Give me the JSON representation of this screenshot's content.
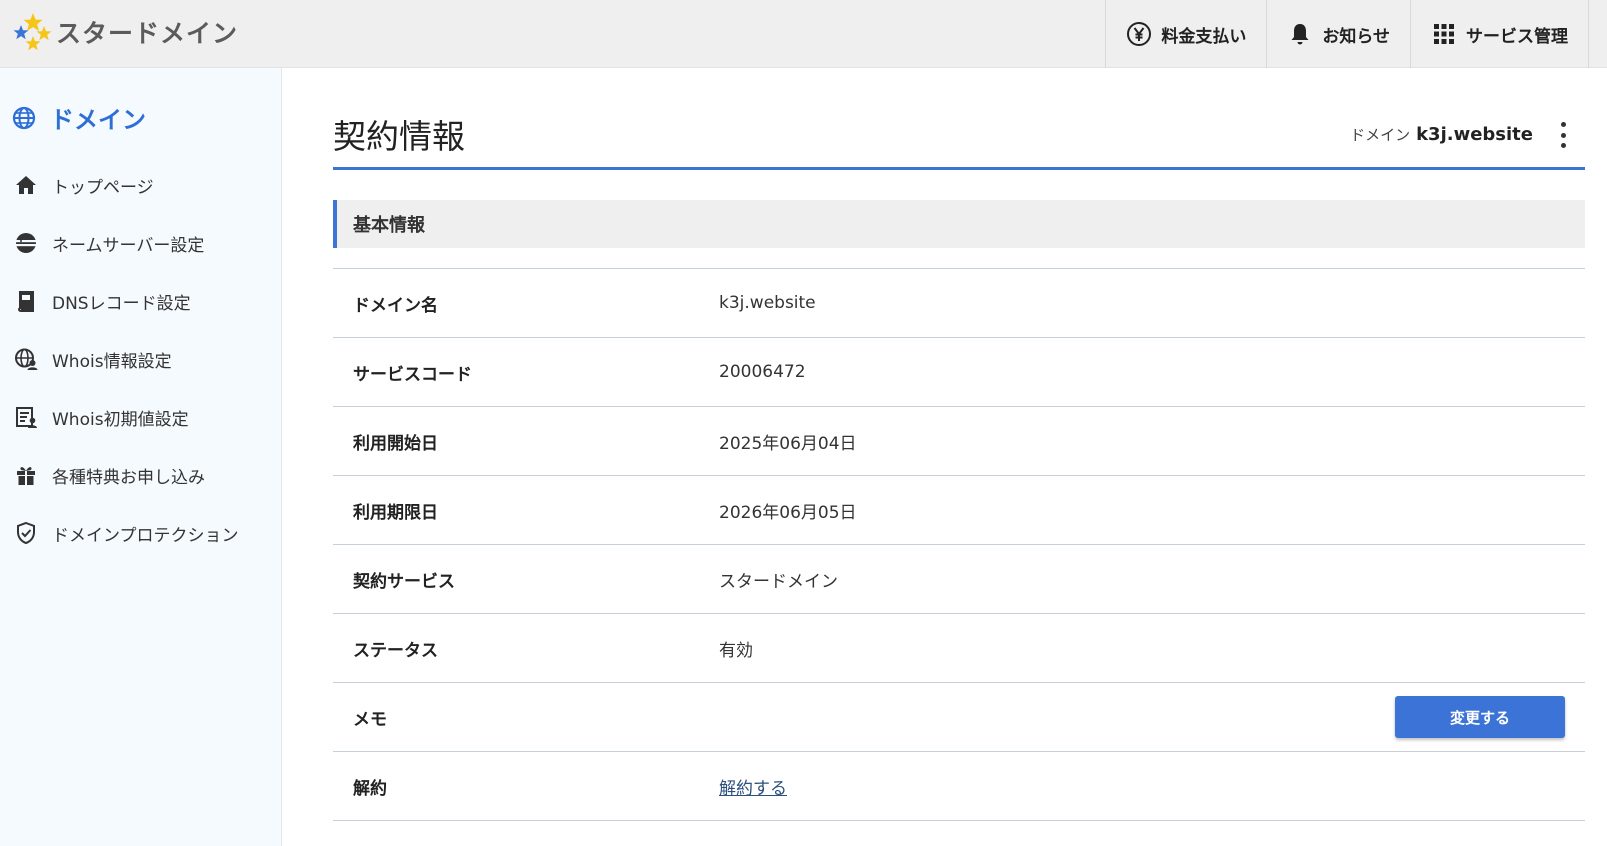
{
  "header": {
    "logo_text": "スタードメイン",
    "nav": [
      {
        "label": "料金支払い",
        "icon": "yen-circle-icon"
      },
      {
        "label": "お知らせ",
        "icon": "bell-icon"
      },
      {
        "label": "サービス管理",
        "icon": "grid-icon"
      }
    ]
  },
  "sidebar": {
    "title": "ドメイン",
    "items": [
      {
        "label": "トップページ",
        "icon": "home-icon"
      },
      {
        "label": "ネームサーバー設定",
        "icon": "nameserver-icon"
      },
      {
        "label": "DNSレコード設定",
        "icon": "book-icon"
      },
      {
        "label": "Whois情報設定",
        "icon": "globe-person-icon"
      },
      {
        "label": "Whois初期値設定",
        "icon": "document-person-icon"
      },
      {
        "label": "各種特典お申し込み",
        "icon": "gift-icon"
      },
      {
        "label": "ドメインプロテクション",
        "icon": "shield-check-icon"
      }
    ]
  },
  "main": {
    "title": "契約情報",
    "domain_label": "ドメイン",
    "domain_value": "k3j.website",
    "section_title": "基本情報",
    "rows": [
      {
        "key": "ドメイン名",
        "value": "k3j.website"
      },
      {
        "key": "サービスコード",
        "value": "20006472"
      },
      {
        "key": "利用開始日",
        "value": "2025年06月04日"
      },
      {
        "key": "利用期限日",
        "value": "2026年06月05日"
      },
      {
        "key": "契約サービス",
        "value": "スタードメイン"
      },
      {
        "key": "ステータス",
        "value": "有効"
      },
      {
        "key": "メモ",
        "value": ""
      },
      {
        "key": "解約",
        "value": ""
      }
    ],
    "memo_button": "変更する",
    "cancel_link": "解約する"
  },
  "colors": {
    "accent": "#3b74d6",
    "header_bg": "#efefef",
    "sidebar_bg": "#f5faff",
    "star_yellow": "#f5c518",
    "star_blue": "#3b74d6"
  }
}
